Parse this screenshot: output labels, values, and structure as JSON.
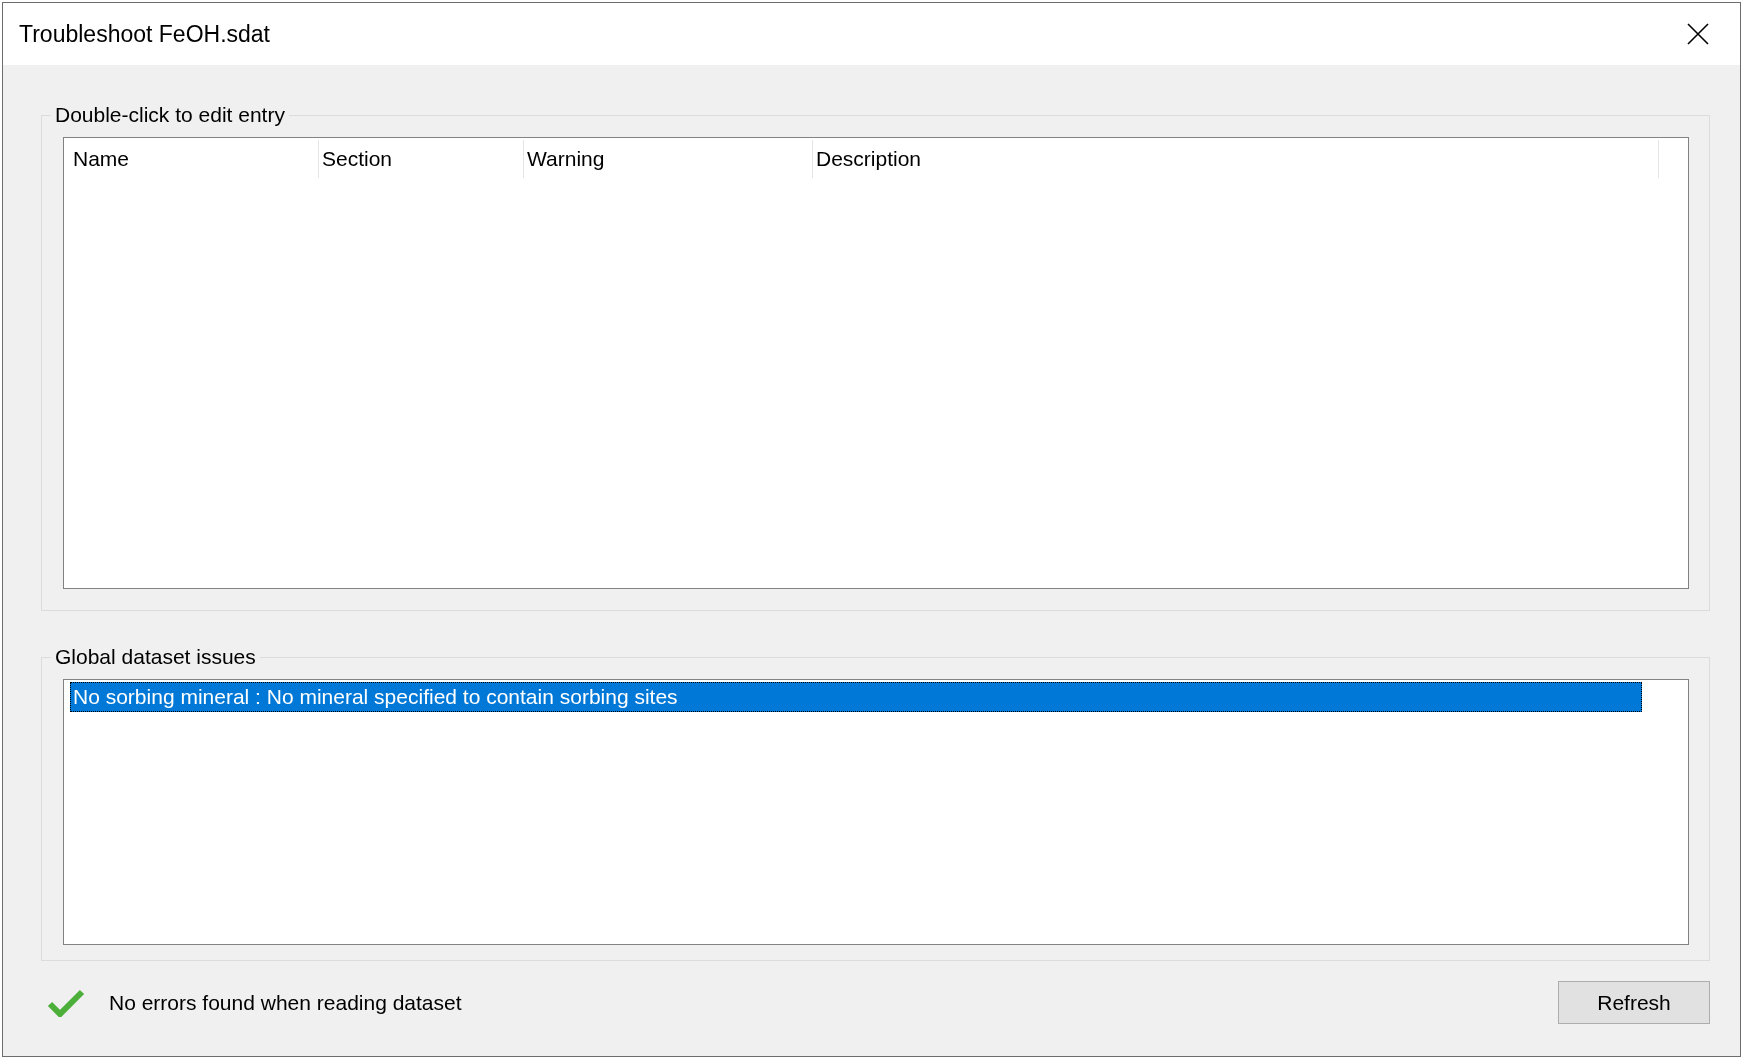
{
  "window": {
    "title": "Troubleshoot FeOH.sdat"
  },
  "entries": {
    "label": "Double-click to edit entry",
    "columns": [
      "Name",
      "Section",
      "Warning",
      "Description"
    ]
  },
  "global_issues": {
    "label": "Global dataset issues",
    "items": [
      {
        "text": "No sorbing mineral : No mineral specified to contain sorbing sites",
        "selected": true
      }
    ]
  },
  "status": {
    "text": "No errors found when reading dataset"
  },
  "buttons": [
    "Refresh"
  ]
}
